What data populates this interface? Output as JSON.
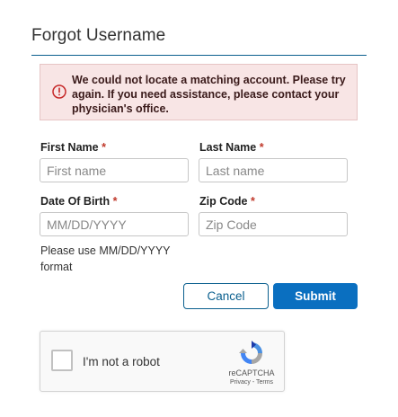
{
  "page": {
    "title": "Forgot Username"
  },
  "alert": {
    "icon": "exclamation-circle-icon",
    "message": "We could not locate a matching account. Please try again. If you need assistance, please contact your physician's office."
  },
  "form": {
    "first_name": {
      "label": "First Name",
      "required_mark": "*",
      "value": "",
      "placeholder": "First name"
    },
    "last_name": {
      "label": "Last Name",
      "required_mark": "*",
      "value": "",
      "placeholder": "Last name"
    },
    "dob": {
      "label": "Date Of Birth",
      "required_mark": "*",
      "value": "",
      "placeholder": "MM/DD/YYYY",
      "hint": "Please use MM/DD/YYYY format"
    },
    "zip": {
      "label": "Zip Code",
      "required_mark": "*",
      "value": "",
      "placeholder": "Zip Code"
    }
  },
  "actions": {
    "cancel_label": "Cancel",
    "submit_label": "Submit"
  },
  "captcha": {
    "label": "I'm not a robot",
    "brand": "reCAPTCHA",
    "privacy": "Privacy",
    "separator": " - ",
    "terms": "Terms",
    "icon": "recaptcha-logo-icon"
  },
  "colors": {
    "accent": "#0a6fc0",
    "rule": "#0a5f8e",
    "alert_bg": "#f8e5e5",
    "required": "#c0392b"
  }
}
